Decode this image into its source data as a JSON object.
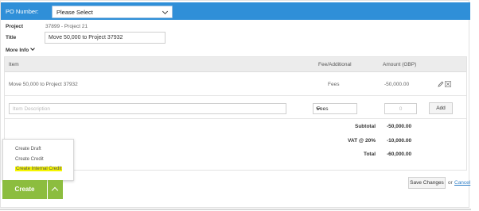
{
  "po_bar": {
    "label": "PO Number:",
    "select_value": "Please Select"
  },
  "project": {
    "label": "Project",
    "value": "37899 - Project 21"
  },
  "title": {
    "label": "Title",
    "value": "Move 50,000 to Project 37932"
  },
  "more_info": {
    "label": "More Info"
  },
  "table": {
    "headers": {
      "item": "Item",
      "fee": "Fee/Additional",
      "amount": "Amount (GBP)"
    },
    "rows": [
      {
        "item": "Move 50,000 to Project 37932",
        "fee": "Fees",
        "amount": "-50,000.00"
      }
    ],
    "new_row": {
      "description_placeholder": "Item Description",
      "fee_select": "Fees",
      "amount_placeholder": "0",
      "add_label": "Add"
    },
    "totals": [
      {
        "label": "Subtotal",
        "value": "-50,000.00"
      },
      {
        "label": "VAT @ 20%",
        "value": "-10,000.00"
      },
      {
        "label": "Total",
        "value": "-60,000.00"
      }
    ]
  },
  "create_menu": {
    "items": [
      "Create Draft",
      "Create Credit",
      "Create Internal Credit"
    ],
    "highlight_color": "#f5f500"
  },
  "actions": {
    "create_label": "Create",
    "save_label": "Save Changes",
    "or_text": "or",
    "cancel_label": "Cancel"
  },
  "colors": {
    "header_blue": "#2f8fd8",
    "create_green": "#8cbd3f",
    "link_blue": "#2f7fc8"
  }
}
